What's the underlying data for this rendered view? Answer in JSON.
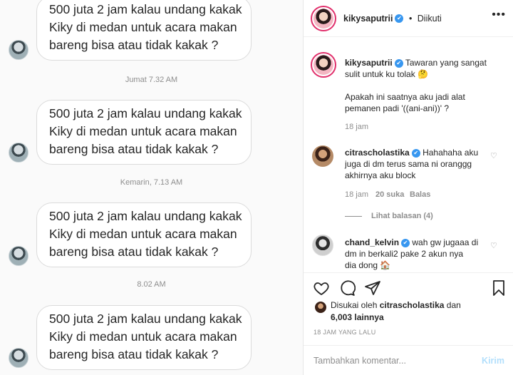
{
  "chat": {
    "message_lines": [
      "500 juta 2 jam kalau undang kakak",
      "Kiky di medan untuk acara makan",
      "bareng bisa atau tidak kakak ?"
    ],
    "timestamps": [
      "Jumat 7.32 AM",
      "Kemarin, 7.13 AM",
      "8.02 AM"
    ]
  },
  "post": {
    "header": {
      "username": "kikysaputrii",
      "separator": "•",
      "follow_status": "Diikuti",
      "more": "•••"
    },
    "caption": {
      "username": "kikysaputrii",
      "line1": "Tawaran yang sangat",
      "line2": "sulit untuk ku tolak 🤔",
      "line3": "Apakah ini saatnya aku jadi alat",
      "line4": "pemanen padi '((ani-ani))' ?",
      "time": "18 jam"
    },
    "comments": [
      {
        "username": "citrascholastika",
        "lines": [
          "Hahahaha aku",
          "juga di dm terus sama ni oranggg",
          "akhirnya aku block"
        ],
        "time": "18 jam",
        "likes": "20 suka",
        "reply": "Balas",
        "view_replies": "Lihat balasan (4)"
      },
      {
        "username": "chand_kelvin",
        "lines": [
          "wah gw jugaaa di",
          "dm in berkali2 pake 2 akun nya",
          "dia dong 🏠"
        ]
      }
    ],
    "liked_by": {
      "prefix": "Disukai oleh",
      "username": "citrascholastika",
      "and": "dan",
      "count": "6,003 lainnya"
    },
    "time_ago": "18 JAM YANG LALU",
    "comment_box": {
      "placeholder": "Tambahkan komentar...",
      "post_label": "Kirim"
    }
  },
  "colors": {
    "accent_blue": "#3897f0",
    "post_disabled": "#b2dffc",
    "muted": "#8e8e8e",
    "story_ring": "#e1306c"
  },
  "icons": [
    "heart-icon",
    "comment-icon",
    "share-icon",
    "bookmark-icon",
    "verified-icon",
    "more-icon"
  ]
}
